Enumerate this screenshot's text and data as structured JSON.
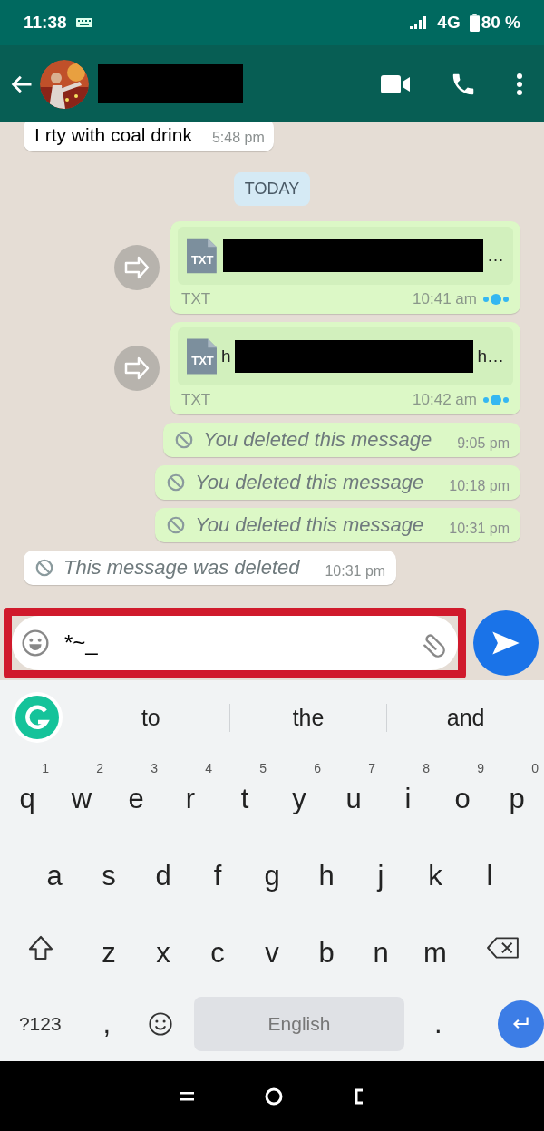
{
  "status_bar": {
    "time": "11:38",
    "network": "4G",
    "battery": "80 %"
  },
  "messages": [
    {
      "kind": "text",
      "outgoing": false,
      "text": "I rty with coal drink",
      "time": "5:48 pm"
    },
    {
      "kind": "date",
      "text": "TODAY"
    },
    {
      "kind": "file",
      "outgoing": true,
      "file_type": "TXT",
      "name_end": "…",
      "label": "TXT",
      "time": "10:41 am",
      "read": true
    },
    {
      "kind": "file",
      "outgoing": true,
      "file_type": "TXT",
      "name_start": "h",
      "name_end": "h…",
      "label": "TXT",
      "time": "10:42 am",
      "read": true
    },
    {
      "kind": "deleted",
      "outgoing": true,
      "text": "You deleted this message",
      "time": "9:05 pm"
    },
    {
      "kind": "deleted",
      "outgoing": true,
      "text": "You deleted this message",
      "time": "10:18 pm"
    },
    {
      "kind": "deleted",
      "outgoing": true,
      "text": "You deleted this message",
      "time": "10:31 pm"
    },
    {
      "kind": "deleted",
      "outgoing": false,
      "text": "This message was deleted",
      "time": "10:31 pm"
    }
  ],
  "composer": {
    "value": "*~_",
    "highlighted": true
  },
  "keyboard": {
    "suggestions": [
      "to",
      "the",
      "and"
    ],
    "rows": [
      [
        {
          "label": "q",
          "hint": "1"
        },
        {
          "label": "w",
          "hint": "2"
        },
        {
          "label": "e",
          "hint": "3"
        },
        {
          "label": "r",
          "hint": "4"
        },
        {
          "label": "t",
          "hint": "5"
        },
        {
          "label": "y",
          "hint": "6"
        },
        {
          "label": "u",
          "hint": "7"
        },
        {
          "label": "i",
          "hint": "8"
        },
        {
          "label": "o",
          "hint": "9"
        },
        {
          "label": "p",
          "hint": "0"
        }
      ],
      [
        {
          "label": "a"
        },
        {
          "label": "s"
        },
        {
          "label": "d"
        },
        {
          "label": "f"
        },
        {
          "label": "g"
        },
        {
          "label": "h"
        },
        {
          "label": "j"
        },
        {
          "label": "k"
        },
        {
          "label": "l"
        }
      ],
      [
        {
          "label": "z"
        },
        {
          "label": "x"
        },
        {
          "label": "c"
        },
        {
          "label": "v"
        },
        {
          "label": "b"
        },
        {
          "label": "n"
        },
        {
          "label": "m"
        }
      ]
    ],
    "symbols_key": "?123",
    "comma_key": ",",
    "space_key": "English",
    "period_key": "."
  }
}
